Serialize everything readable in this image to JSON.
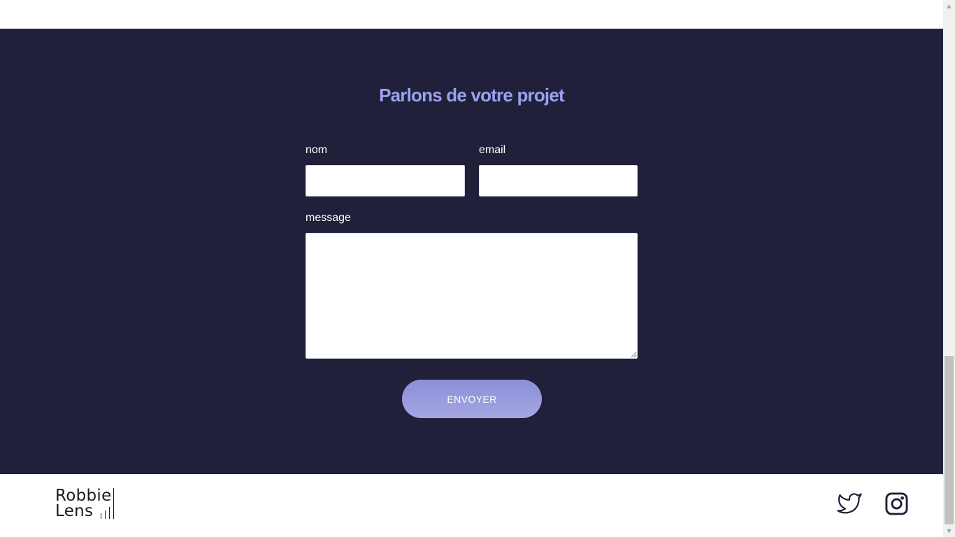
{
  "contact": {
    "title": "Parlons de votre projet",
    "fields": {
      "name": {
        "label": "nom",
        "value": "",
        "placeholder": ""
      },
      "email": {
        "label": "email",
        "value": "",
        "placeholder": ""
      },
      "message": {
        "label": "message",
        "value": "",
        "placeholder": ""
      }
    },
    "submit_label": "ENVOYER"
  },
  "footer": {
    "logo_line1": "Robbie",
    "logo_line2": "Lens",
    "social": [
      {
        "name": "twitter",
        "icon": "twitter-icon"
      },
      {
        "name": "instagram",
        "icon": "instagram-icon"
      }
    ]
  },
  "colors": {
    "section_bg": "#20203a",
    "title": "#9aa2ee",
    "button": "#9597dc"
  }
}
